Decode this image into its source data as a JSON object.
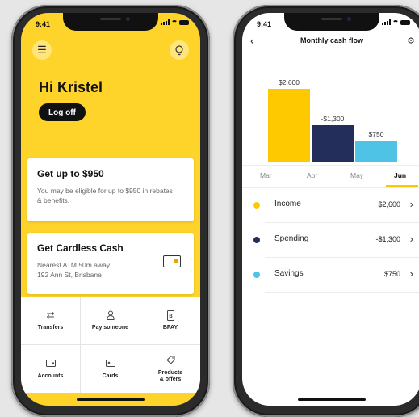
{
  "left_phone": {
    "status": {
      "time": "9:41"
    },
    "header": {
      "menu_icon": "hamburger-icon",
      "bulb_icon": "lightbulb-icon"
    },
    "greeting": "Hi Kristel",
    "logoff_label": "Log off",
    "promo_card": {
      "title": "Get up to $950",
      "text": "You may be eligible for up to $950 in rebates & benefits."
    },
    "cardless_card": {
      "title": "Get Cardless Cash",
      "line1": "Nearest ATM 50m away",
      "line2": "192 Ann St, Brisbane",
      "icon": "atm-card-icon"
    },
    "quick_actions": [
      {
        "label": "Transfers",
        "icon": "shuffle-icon"
      },
      {
        "label": "Pay someone",
        "icon": "person-icon"
      },
      {
        "label": "BPAY",
        "icon": "bpay-icon"
      },
      {
        "label": "Accounts",
        "icon": "wallet-icon"
      },
      {
        "label": "Cards",
        "icon": "card-icon"
      },
      {
        "label": "Products & offers",
        "icon": "tag-icon"
      }
    ]
  },
  "right_phone": {
    "status": {
      "time": "9:41"
    },
    "nav": {
      "title": "Monthly cash flow"
    },
    "months": [
      "Mar",
      "Apr",
      "May",
      "Jun"
    ],
    "active_month": "Jun",
    "rows": [
      {
        "label": "Income",
        "value": "$2,600",
        "color": "#ffc900"
      },
      {
        "label": "Spending",
        "value": "-$1,300",
        "color": "#232f5a"
      },
      {
        "label": "Savings",
        "value": "$750",
        "color": "#4ec3e6"
      }
    ]
  },
  "chart_data": {
    "type": "bar",
    "categories": [
      "Income",
      "Spending",
      "Savings"
    ],
    "values": [
      2600,
      -1300,
      750
    ],
    "labels": [
      "$2,600",
      "-$1,300",
      "$750"
    ],
    "colors": [
      "#ffc900",
      "#232f5a",
      "#4ec3e6"
    ],
    "title": "",
    "xlabel": "",
    "ylabel": "",
    "grid": false
  }
}
